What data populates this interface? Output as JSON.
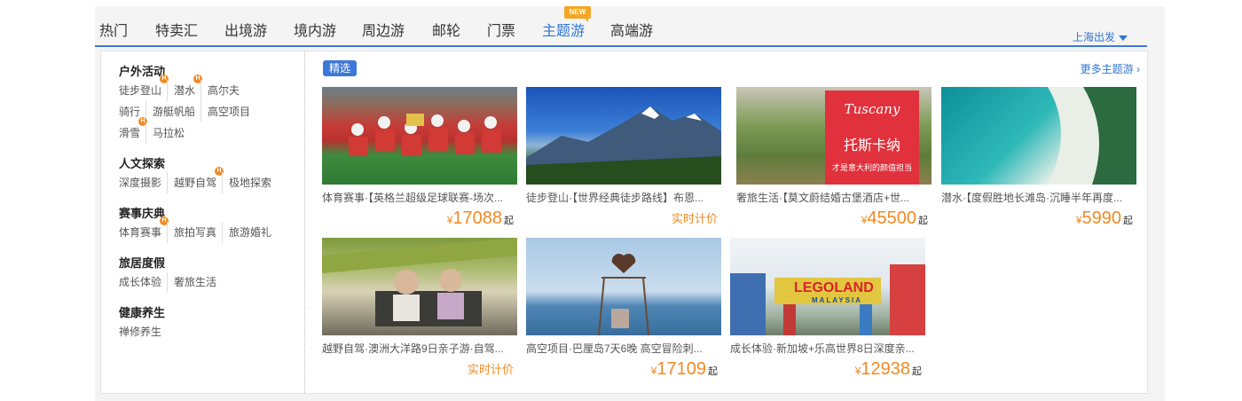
{
  "tabs": [
    "热门",
    "特卖汇",
    "出境游",
    "境内游",
    "周边游",
    "邮轮",
    "门票",
    "主题游",
    "高端游"
  ],
  "new_badge": "NEW",
  "depart_label": "上海出发",
  "featured_label": "精选",
  "more_label": "更多主题游",
  "categories": [
    {
      "title": "户外活动",
      "items": [
        "徒步登山",
        "潜水",
        "高尔夫",
        "骑行",
        "游艇帆船",
        "高空项目",
        "滑雪",
        "马拉松"
      ]
    },
    {
      "title": "人文探索",
      "items": [
        "深度摄影",
        "越野自驾",
        "极地探索"
      ]
    },
    {
      "title": "赛事庆典",
      "items": [
        "体育赛事",
        "旅拍写真",
        "旅游婚礼"
      ]
    },
    {
      "title": "旅居度假",
      "items": [
        "成长体验",
        "奢旅生活"
      ]
    },
    {
      "title": "健康养生",
      "items": [
        "禅修养生"
      ]
    }
  ],
  "hot_badge": "H",
  "currency": "¥",
  "price_suffix": "起",
  "products": [
    {
      "title": "体育赛事·【英格兰超级足球联赛-场次...",
      "price": "17088",
      "image": "football-team-photo"
    },
    {
      "title": "徒步登山·【世界经典徒步路线】布恩...",
      "price_text": "实时计价",
      "image": "mountain-landscape-photo"
    },
    {
      "title": "奢旅生活·【莫文蔚结婚古堡酒店+世...",
      "price": "45500",
      "image": "tuscany-landscape-photo",
      "overlay": {
        "en": "Tuscany",
        "cn": "托斯卡纳",
        "sub": "才是意大利的颜值担当"
      }
    },
    {
      "title": "潜水·【度假胜地长滩岛·沉睡半年再度...",
      "price": "5990",
      "image": "beach-aerial-photo"
    },
    {
      "title": "越野自驾·澳洲大洋路9日亲子游·自驾...",
      "price_text": "实时计价",
      "image": "family-car-photo"
    },
    {
      "title": "高空项目·巴厘岛7天6晚 高空冒险刺...",
      "price": "17109",
      "image": "bali-swing-photo"
    },
    {
      "title": "成长体验·新加坡+乐高世界8日深度亲...",
      "price": "12938",
      "image": "legoland-photo",
      "overlay": {
        "en": "LEGOLAND",
        "sub": "MALAYSIA"
      }
    }
  ]
}
